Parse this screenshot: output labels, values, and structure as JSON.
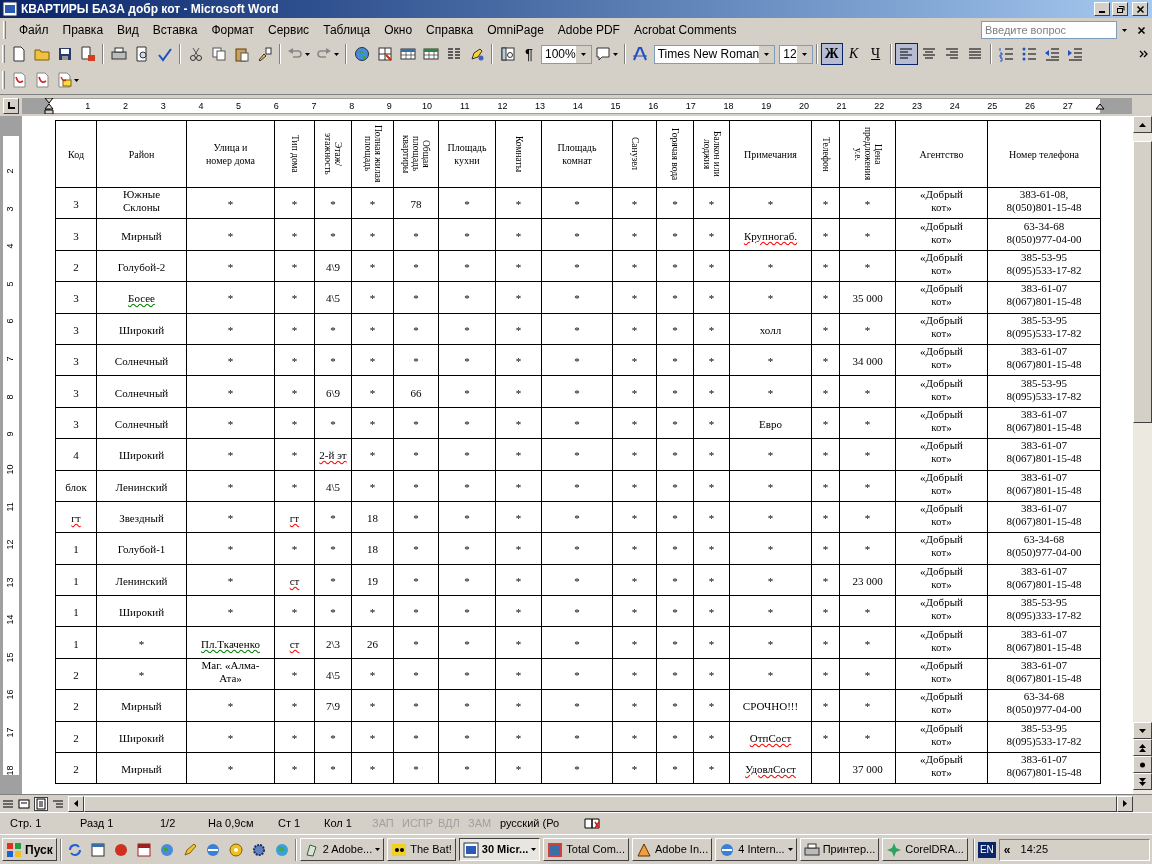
{
  "window": {
    "title": "КВАРТИРЫ БАЗА добр кот - Microsoft Word"
  },
  "menu": [
    "Файл",
    "Правка",
    "Вид",
    "Вставка",
    "Формат",
    "Сервис",
    "Таблица",
    "Окно",
    "Справка",
    "OmniPage",
    "Adobe PDF",
    "Acrobat Comments"
  ],
  "help_box": {
    "placeholder": "Введите вопрос"
  },
  "toolbar": {
    "show_marks": "¶",
    "zoom": "100%",
    "font": "Times New Roman",
    "size": "12",
    "format_buttons": [
      {
        "label": "Ж",
        "selected": true
      },
      {
        "label": "К",
        "selected": false
      },
      {
        "label": "Ч",
        "selected": false
      }
    ],
    "alignment_buttons": [
      {
        "selected": true
      },
      {
        "selected": false
      },
      {
        "selected": false
      },
      {
        "selected": false
      }
    ]
  },
  "ruler": {
    "labels": [
      "1",
      "2",
      "3",
      "4",
      "5",
      "6",
      "7",
      "8",
      "9",
      "10",
      "11",
      "12",
      "13",
      "14",
      "15",
      "16",
      "17",
      "18",
      "19",
      "20",
      "21",
      "22",
      "23",
      "24",
      "25",
      "26",
      "27"
    ]
  },
  "vertical_ruler": {
    "labels": [
      "2",
      "3",
      "4",
      "5",
      "6",
      "7",
      "8",
      "9",
      "10",
      "11",
      "12",
      "13",
      "14",
      "15",
      "16",
      "17",
      "18"
    ]
  },
  "table": {
    "columns": [
      {
        "label": "Код",
        "vertical": false
      },
      {
        "label": "Район",
        "vertical": false
      },
      {
        "label": "Улица и номер дома",
        "vertical": false
      },
      {
        "label": "Тип дома",
        "vertical": true
      },
      {
        "label": "Этаж/этажность",
        "vertical": true
      },
      {
        "label": "Полная жилая площадь",
        "vertical": true
      },
      {
        "label": "Общая площадь квартиры",
        "vertical": true
      },
      {
        "label": "Площадь кухни",
        "vertical": false
      },
      {
        "label": "Комнаты",
        "vertical": true
      },
      {
        "label": "Площадь комнат",
        "vertical": false
      },
      {
        "label": "Санузел",
        "vertical": true
      },
      {
        "label": "Горячая вода",
        "vertical": true
      },
      {
        "label": "Балкон или лоджия",
        "vertical": true
      },
      {
        "label": "Примечания",
        "vertical": false
      },
      {
        "label": "Телефон",
        "vertical": true
      },
      {
        "label": "Цена предложения у.е.",
        "vertical": true
      },
      {
        "label": "Агентство",
        "vertical": false
      },
      {
        "label": "Номер телефона",
        "vertical": false
      }
    ],
    "rows": [
      {
        "cells": [
          "3",
          "Южные Склоны",
          "*",
          "*",
          "*",
          "*",
          "78",
          "*",
          "*",
          "*",
          "*",
          "*",
          "*",
          "*",
          "*",
          "*",
          "«Добрый кот»",
          "383-61-08, 8(050)801-15-48"
        ]
      },
      {
        "cells": [
          "3",
          "Мирный",
          "*",
          "*",
          "*",
          "*",
          "*",
          "*",
          "*",
          "*",
          "*",
          "*",
          "*",
          {
            "text": "Крупногаб.",
            "spelling_error": true
          },
          "*",
          "*",
          "«Добрый кот»",
          "63-34-68 8(050)977-04-00"
        ]
      },
      {
        "cells": [
          "2",
          "Голубой-2",
          "*",
          "*",
          "4\\9",
          "*",
          "*",
          "*",
          "*",
          "*",
          "*",
          "*",
          "*",
          "*",
          "*",
          "*",
          "«Добрый кот»",
          "385-53-95 8(095)533-17-82"
        ]
      },
      {
        "cells": [
          "3",
          {
            "text": "Босее",
            "grammar_error": true
          },
          "*",
          "*",
          "4\\5",
          "*",
          "*",
          "*",
          "*",
          "*",
          "*",
          "*",
          "*",
          "*",
          "*",
          "35 000",
          "«Добрый кот»",
          "383-61-07 8(067)801-15-48"
        ]
      },
      {
        "cells": [
          "3",
          "Широкий",
          "*",
          "*",
          "*",
          "*",
          "*",
          "*",
          "*",
          "*",
          "*",
          "*",
          "*",
          "холл",
          "*",
          "*",
          "«Добрый кот»",
          "385-53-95 8(095)533-17-82"
        ]
      },
      {
        "cells": [
          "3",
          "Солнечный",
          "*",
          "*",
          "*",
          "*",
          "*",
          "*",
          "*",
          "*",
          "*",
          "*",
          "*",
          "*",
          "*",
          "34 000",
          "«Добрый кот»",
          "383-61-07 8(067)801-15-48"
        ]
      },
      {
        "cells": [
          "3",
          "Солнечный",
          "*",
          "*",
          "6\\9",
          "*",
          "66",
          "*",
          "*",
          "*",
          "*",
          "*",
          "*",
          "*",
          "*",
          "*",
          "«Добрый кот»",
          "385-53-95 8(095)533-17-82"
        ]
      },
      {
        "cells": [
          "3",
          "Солнечный",
          "*",
          "*",
          "*",
          "*",
          "*",
          "*",
          "*",
          "*",
          "*",
          "*",
          "*",
          "Евро",
          "*",
          "*",
          "«Добрый кот»",
          "383-61-07 8(067)801-15-48"
        ]
      },
      {
        "cells": [
          "4",
          "Широкий",
          "*",
          "*",
          {
            "text": "2-й эт",
            "spelling_error": true
          },
          "*",
          "*",
          "*",
          "*",
          "*",
          "*",
          "*",
          "*",
          "*",
          "*",
          "*",
          "«Добрый кот»",
          "383-61-07 8(067)801-15-48"
        ]
      },
      {
        "cells": [
          "блок",
          "Ленинский",
          "*",
          "*",
          "4\\5",
          "*",
          "*",
          "*",
          "*",
          "*",
          "*",
          "*",
          "*",
          "*",
          "*",
          "*",
          "«Добрый кот»",
          "383-61-07 8(067)801-15-48"
        ]
      },
      {
        "cells": [
          {
            "text": "гт",
            "spelling_error": true
          },
          "Звездный",
          "*",
          {
            "text": "гт",
            "spelling_error": true
          },
          "*",
          "18",
          "*",
          "*",
          "*",
          "*",
          "*",
          "*",
          "*",
          "*",
          "*",
          "*",
          "«Добрый кот»",
          "383-61-07 8(067)801-15-48"
        ]
      },
      {
        "cells": [
          "1",
          "Голубой-1",
          "*",
          "*",
          "*",
          "18",
          "*",
          "*",
          "*",
          "*",
          "*",
          "*",
          "*",
          "*",
          "*",
          "*",
          "«Добрый кот»",
          "63-34-68 8(050)977-04-00"
        ]
      },
      {
        "cells": [
          "1",
          "Ленинский",
          "*",
          {
            "text": "ст",
            "spelling_error": true
          },
          "*",
          "19",
          "*",
          "*",
          "*",
          "*",
          "*",
          "*",
          "*",
          "*",
          "*",
          "23 000",
          "«Добрый кот»",
          "383-61-07 8(067)801-15-48"
        ]
      },
      {
        "cells": [
          "1",
          "Широкий",
          "*",
          "*",
          "*",
          "*",
          "*",
          "*",
          "*",
          "*",
          "*",
          "*",
          "*",
          "*",
          "*",
          "*",
          "«Добрый кот»",
          "385-53-95 8(095)333-17-82"
        ]
      },
      {
        "cells": [
          "1",
          "*",
          {
            "text": "Пл.Ткаченко",
            "grammar_error": true
          },
          {
            "text": "ст",
            "spelling_error": true
          },
          "2\\3",
          "26",
          "*",
          "*",
          "*",
          "*",
          "*",
          "*",
          "*",
          "*",
          "*",
          "*",
          "«Добрый кот»",
          "383-61-07 8(067)801-15-48"
        ]
      },
      {
        "cells": [
          "2",
          "*",
          "Маг. «Алма-Ата»",
          "*",
          "4\\5",
          "*",
          "*",
          "*",
          "*",
          "*",
          "*",
          "*",
          "*",
          "*",
          "*",
          "*",
          "«Добрый кот»",
          "383-61-07 8(067)801-15-48"
        ]
      },
      {
        "cells": [
          "2",
          "Мирный",
          "*",
          "*",
          "7\\9",
          "*",
          "*",
          "*",
          "*",
          "*",
          "*",
          "*",
          "*",
          "СРОЧНО!!!",
          "*",
          "*",
          "«Добрый кот»",
          "63-34-68 8(050)977-04-00"
        ]
      },
      {
        "cells": [
          "2",
          "Широкий",
          "*",
          "*",
          "*",
          "*",
          "*",
          "*",
          "*",
          "*",
          "*",
          "*",
          "*",
          {
            "text": "ОтпСост",
            "spelling_error": true
          },
          "*",
          "*",
          "«Добрый кот»",
          "385-53-95 8(095)533-17-82"
        ]
      },
      {
        "cells": [
          "2",
          "Мирный",
          "*",
          "*",
          "*",
          "*",
          "*",
          "*",
          "*",
          "*",
          "*",
          "*",
          "*",
          {
            "text": "УдовлСост",
            "spelling_error": true
          },
          null,
          "37 000",
          "«Добрый кот»",
          "383-61-07 8(067)801-15-48"
        ]
      }
    ]
  },
  "status_bar": [
    {
      "label": "Стр. 1",
      "disabled": false
    },
    {
      "label": "Разд 1",
      "disabled": false
    },
    {
      "label": "1/2",
      "disabled": false
    },
    {
      "label": "На 0,9см",
      "disabled": false
    },
    {
      "label": "Ст 1",
      "disabled": false
    },
    {
      "label": "Кол 1",
      "disabled": false
    },
    {
      "label": "ЗАП",
      "disabled": true
    },
    {
      "label": "ИСПР",
      "disabled": true
    },
    {
      "label": "ВДЛ",
      "disabled": true
    },
    {
      "label": "ЗАМ",
      "disabled": true
    },
    {
      "label": "русский (Ро",
      "disabled": false
    }
  ],
  "taskbar": {
    "start": "Пуск",
    "tasks": [
      {
        "label": "2 Adobe...",
        "grouped": true,
        "selected": false
      },
      {
        "label": "The Bat!",
        "grouped": false,
        "selected": false
      },
      {
        "label": "30 Micr...",
        "grouped": true,
        "selected": true
      },
      {
        "label": "Total Com...",
        "grouped": false,
        "selected": false
      },
      {
        "label": "Adobe In...",
        "grouped": false,
        "selected": false
      },
      {
        "label": "4 Intern...",
        "grouped": true,
        "selected": false
      },
      {
        "label": "Принтер...",
        "grouped": false,
        "selected": false
      },
      {
        "label": "CorelDRA...",
        "grouped": false,
        "selected": false
      }
    ],
    "language": "EN",
    "tray_toggle": "«",
    "clock": "14:25"
  }
}
